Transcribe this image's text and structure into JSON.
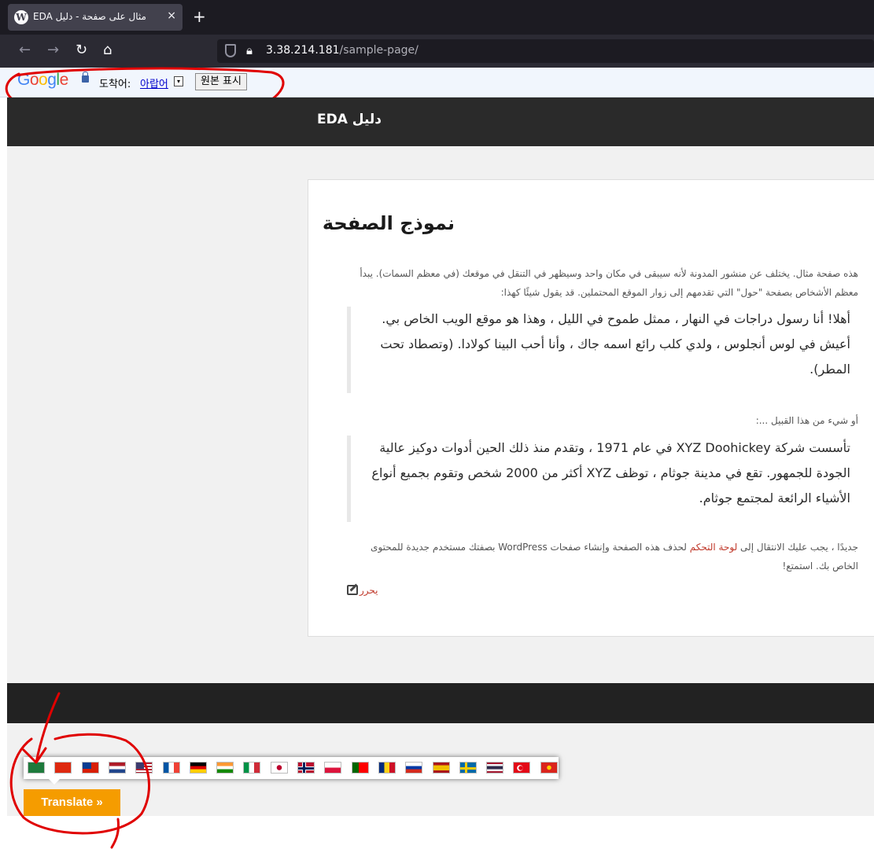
{
  "browser": {
    "tab_title": "EDA مثال على صفحة - دليل",
    "tab_close": "×",
    "new_tab": "+",
    "url_host": "3.38.214.181",
    "url_path": "/sample-page/",
    "icons": [
      "wordpress-icon",
      "back-icon",
      "forward-icon",
      "reload-icon",
      "home-icon",
      "shield-icon",
      "lock-icon"
    ]
  },
  "google_translate_bar": {
    "logo": [
      "G",
      "o",
      "o",
      "g",
      "l",
      "e"
    ],
    "label": "도착어:",
    "language": "아랍어",
    "dropdown_arrow": "▾",
    "show_original": "원본 표시"
  },
  "site": {
    "title": "دليل EDA"
  },
  "page": {
    "title": "نموذج الصفحة",
    "intro": "هذه صفحة مثال. يختلف عن منشور المدونة لأنه سيبقى في مكان واحد وسيظهر في التنقل في موقعك (في معظم السمات). يبدأ معظم الأشخاص بصفحة \"حول\" التي تقدمهم إلى زوار الموقع المحتملين. قد يقول شيئًا كهذا:",
    "quote1": "أهلا! أنا رسول دراجات في النهار ، ممثل طموح في الليل ، وهذا هو موقع الويب الخاص بي. أعيش في لوس أنجلوس ، ولدي كلب رائع اسمه جاك ، وأنا أحب البينا كولادا. (وتصطاد تحت المطر).",
    "or_text": "أو شيء من هذا القبيل ...:",
    "quote2": "تأسست شركة XYZ Doohickey في عام 1971 ، وتقدم منذ ذلك الحين أدوات دوكيز عالية الجودة للجمهور. تقع في مدينة جوثام ، توظف XYZ أكثر من 2000 شخص وتقوم بجميع أنواع الأشياء الرائعة لمجتمع جوثام.",
    "final_before": "جديدًا ، يجب عليك الانتقال إلى ",
    "final_link": "لوحة التحكم",
    "final_after": " لحذف هذه الصفحة وإنشاء صفحات WordPress بصفتك مستخدم جديدة للمحتوى الخاص بك. استمتع!",
    "edit_link": "يحرر"
  },
  "translate_widget": {
    "flags": [
      "saudi-arabia",
      "china",
      "taiwan",
      "netherlands",
      "united-states",
      "france",
      "germany",
      "india",
      "italy",
      "japan",
      "norway",
      "poland",
      "portugal",
      "romania",
      "russia",
      "spain",
      "sweden",
      "thailand",
      "turkey",
      "vietnam"
    ],
    "button_label": "Translate »"
  },
  "colors": {
    "annotation_red": "#e00000",
    "translate_button": "#f59c00",
    "link": "#c0392b"
  }
}
